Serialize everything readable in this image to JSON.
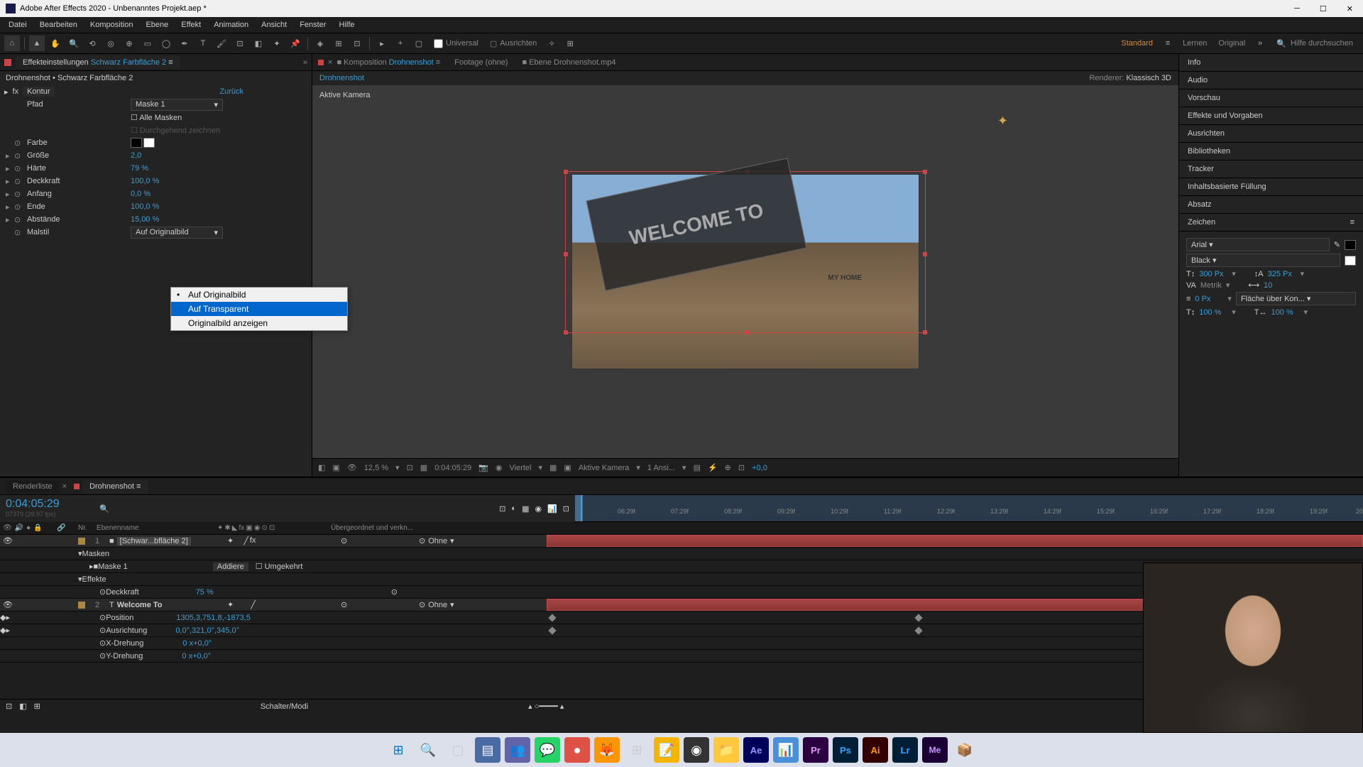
{
  "titlebar": {
    "app": "Adobe After Effects 2020 - Unbenanntes Projekt.aep *"
  },
  "menubar": {
    "items": [
      "Datei",
      "Bearbeiten",
      "Komposition",
      "Ebene",
      "Effekt",
      "Animation",
      "Ansicht",
      "Fenster",
      "Hilfe"
    ]
  },
  "toolbar": {
    "universal": "Universal",
    "align": "Ausrichten",
    "workspace1": "Standard",
    "workspace2": "Lernen",
    "workspace3": "Original",
    "search_placeholder": "Hilfe durchsuchen"
  },
  "effects_panel": {
    "tab": "Effekteinstellungen",
    "layer": "Schwarz Farbfläche 2",
    "breadcrumb": "Drohnenshot • Schwarz Farbfläche 2",
    "effect_name": "Kontur",
    "reset": "Zurück",
    "props": {
      "pfad": "Pfad",
      "pfad_value": "Maske 1",
      "alle_masken": "Alle Masken",
      "durchgehend": "Durchgehend zeichnen",
      "farbe": "Farbe",
      "groesse": "Größe",
      "groesse_val": "2,0",
      "haerte": "Härte",
      "haerte_val": "79 %",
      "deckkraft": "Deckkraft",
      "deckkraft_val": "100,0 %",
      "anfang": "Anfang",
      "anfang_val": "0,0 %",
      "ende": "Ende",
      "ende_val": "100,0 %",
      "abstaende": "Abstände",
      "abstaende_val": "15,00 %",
      "malstil": "Malstil",
      "malstil_val": "Auf Originalbild"
    },
    "dropdown": {
      "opt1": "Auf Originalbild",
      "opt2": "Auf Transparent",
      "opt3": "Originalbild anzeigen"
    }
  },
  "comp": {
    "tab_komposition": "Komposition",
    "tab_komposition_val": "Drohnenshot",
    "tab_footage": "Footage",
    "tab_footage_val": "(ohne)",
    "tab_ebene": "Ebene",
    "tab_ebene_val": "Drohnenshot.mp4",
    "breadcrumb": "Drohnenshot",
    "renderer_label": "Renderer:",
    "renderer_val": "Klassisch 3D",
    "camera_label": "Aktive Kamera",
    "welcome_text": "WELCOME TO",
    "my_home": "MY HOME",
    "zoom": "12,5 %",
    "time": "0:04:05:29",
    "quality": "Viertel",
    "view": "Aktive Kamera",
    "view_count": "1 Ansi...",
    "exposure": "+0,0"
  },
  "right_panels": {
    "info": "Info",
    "audio": "Audio",
    "vorschau": "Vorschau",
    "effekte": "Effekte und Vorgaben",
    "ausrichten": "Ausrichten",
    "bibliotheken": "Bibliotheken",
    "tracker": "Tracker",
    "inhalt": "Inhaltsbasierte Füllung",
    "absatz": "Absatz",
    "zeichen": "Zeichen",
    "font": "Arial",
    "weight": "Black",
    "size": "300 Px",
    "leading": "325 Px",
    "kerning": "Metrik",
    "tracking": "10",
    "stroke_w": "0 Px",
    "stroke_style": "Fläche über Kon...",
    "scale_v": "100 %",
    "scale_h": "100 %"
  },
  "timeline": {
    "tab1": "Renderliste",
    "tab2": "Drohnenshot",
    "timecode": "0:04:05:29",
    "frame_sub": "07379 (29.97 fps)",
    "col_num": "Nr.",
    "col_name": "Ebenenname",
    "col_parent": "Übergeordnet und verkn...",
    "ruler_ticks": [
      "06:29f",
      "07:29f",
      "08:29f",
      "09:29f",
      "10:29f",
      "11:29f",
      "12:29f",
      "13:29f",
      "14:29f",
      "15:29f",
      "16:29f",
      "17:29f",
      "18:29f",
      "19:29f",
      "20"
    ],
    "layer1_num": "1",
    "layer1_name": "[Schwar...bfläche 2]",
    "layer1_parent": "Ohne",
    "layer1_masken": "Masken",
    "layer1_maske1": "Maske 1",
    "layer1_maske1_mode": "Addiere",
    "layer1_maske1_inv": "Umgekehrt",
    "layer1_effekte": "Effekte",
    "layer1_deckkraft": "Deckkraft",
    "layer1_deckkraft_val": "75 %",
    "layer2_num": "2",
    "layer2_name": "Welcome To",
    "layer2_parent": "Ohne",
    "layer2_position": "Position",
    "layer2_position_val": "1305,3,751,8,-1873,5",
    "layer2_ausrichtung": "Ausrichtung",
    "layer2_ausrichtung_val": "0,0°,321,0°,345,0°",
    "layer2_xdrehung": "X-Drehung",
    "layer2_xdrehung_val": "0 x+0,0°",
    "layer2_ydrehung": "Y-Drehung",
    "layer2_ydrehung_val": "0 x+0,0°",
    "footer": "Schalter/Modi"
  }
}
